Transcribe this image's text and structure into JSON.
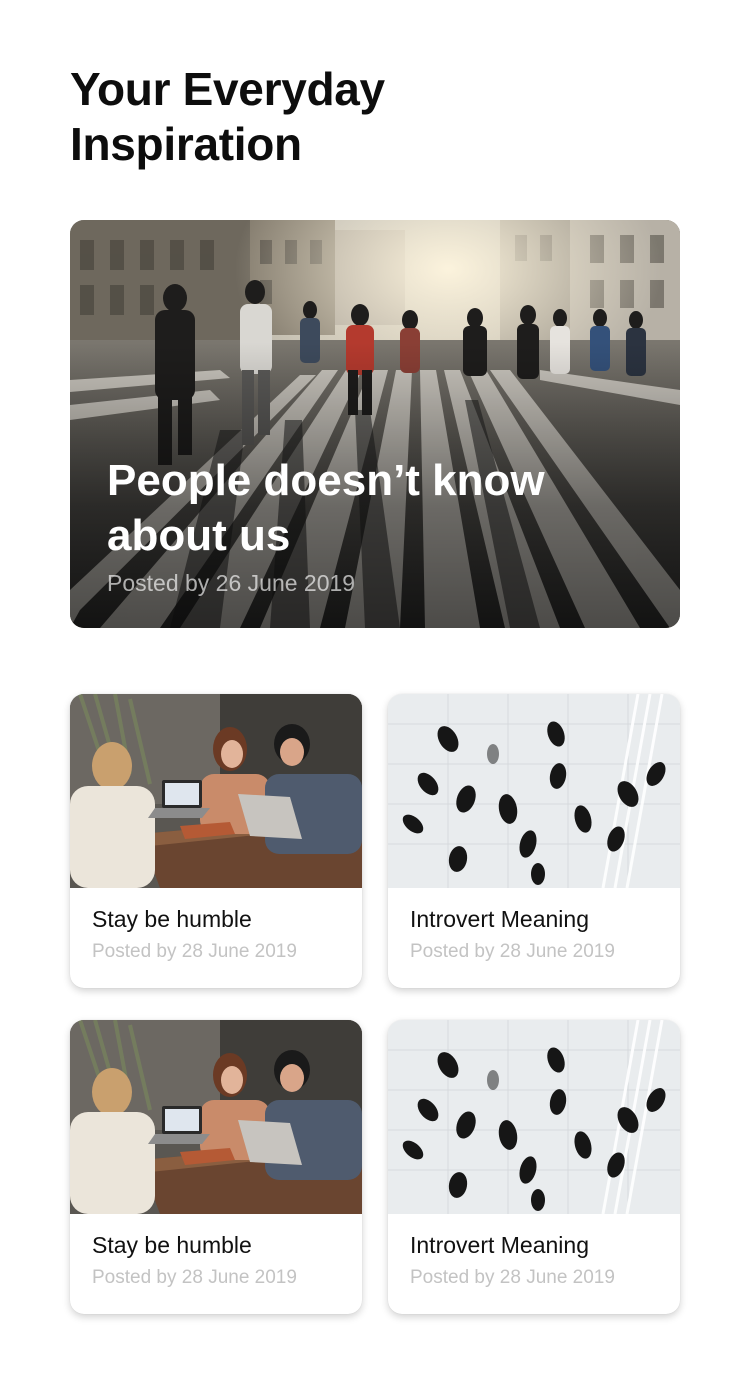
{
  "page": {
    "title": "Your Everyday Inspiration"
  },
  "featured": {
    "title": "People doesn’t know about us",
    "meta": "Posted by 26 June 2019",
    "image": "crowd-crosswalk-photo"
  },
  "posts": [
    {
      "title": "Stay be humble",
      "meta": "Posted by 28 June 2019",
      "image": "friends-cafe-laptops-photo"
    },
    {
      "title": "Introvert Meaning",
      "meta": "Posted by 28 June 2019",
      "image": "aerial-walkers-photo"
    },
    {
      "title": "Stay be humble",
      "meta": "Posted by 28 June 2019",
      "image": "friends-cafe-laptops-photo"
    },
    {
      "title": "Introvert Meaning",
      "meta": "Posted by 28 June 2019",
      "image": "aerial-walkers-photo"
    }
  ],
  "colors": {
    "background": "#ffffff",
    "title_text": "#0d0d0d",
    "meta_text": "#c3c3c3",
    "hero_text": "#ffffff"
  }
}
